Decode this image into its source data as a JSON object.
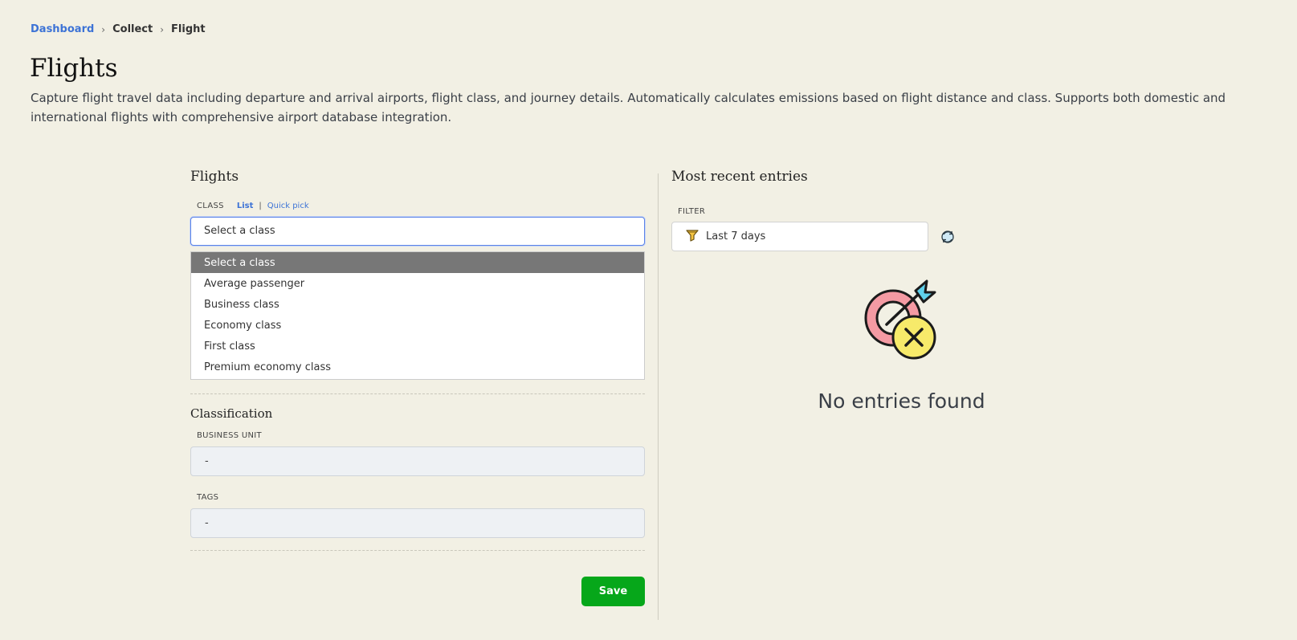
{
  "breadcrumb": {
    "items": [
      "Dashboard",
      "Collect",
      "Flight"
    ]
  },
  "page": {
    "title": "Flights",
    "description": "Capture flight travel data including departure and arrival airports, flight class, and journey details. Automatically calculates emissions based on flight distance and class. Supports both domestic and international flights with comprehensive airport database integration."
  },
  "form": {
    "section_title": "Flights",
    "class_label": "CLASS",
    "mode_list": "List",
    "mode_separator": "|",
    "mode_quick_pick": "Quick pick",
    "class_value": "Select a class",
    "class_options": [
      "Select a class",
      "Average passenger",
      "Business class",
      "Economy class",
      "First class",
      "Premium economy class"
    ],
    "classification_title": "Classification",
    "business_unit_label": "BUSINESS UNIT",
    "business_unit_value": "-",
    "tags_label": "TAGS",
    "tags_value": "-",
    "save_label": "Save"
  },
  "entries": {
    "title": "Most recent entries",
    "filter_label": "FILTER",
    "filter_value": "Last 7 days",
    "empty_text": "No entries found"
  },
  "icons": {
    "breadcrumb_separator": "chevron-right-icon",
    "filter": "funnel-icon",
    "refresh": "refresh-icon",
    "empty": "target-missed-illustration"
  },
  "colors": {
    "background": "#f2f0e4",
    "link": "#3d73d6",
    "save_button": "#06a71a",
    "selected_option": "#777777",
    "focus_border": "#5b83e6"
  }
}
